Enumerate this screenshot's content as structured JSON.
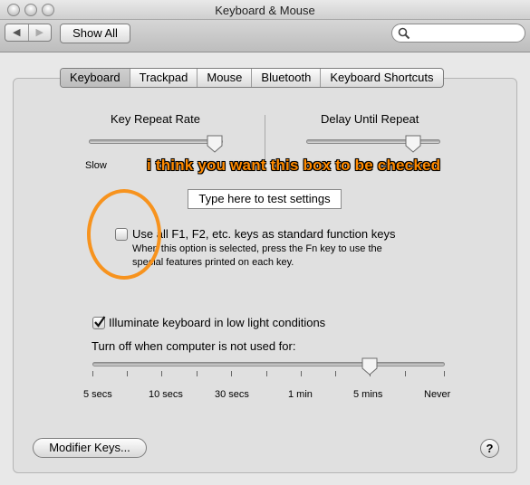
{
  "window": {
    "title": "Keyboard & Mouse"
  },
  "toolbar": {
    "back_glyph": "◀",
    "forward_glyph": "▶",
    "show_all_label": "Show All",
    "search_placeholder": ""
  },
  "tabs": [
    {
      "label": "Keyboard",
      "selected": true
    },
    {
      "label": "Trackpad",
      "selected": false
    },
    {
      "label": "Mouse",
      "selected": false
    },
    {
      "label": "Bluetooth",
      "selected": false
    },
    {
      "label": "Keyboard Shortcuts",
      "selected": false
    }
  ],
  "key_repeat": {
    "label": "Key Repeat Rate",
    "left_label": "Slow",
    "value_fraction": 0.94
  },
  "delay_repeat": {
    "label": "Delay Until Repeat",
    "value_fraction": 0.8
  },
  "test_field": {
    "value": "Type here to test settings"
  },
  "function_keys": {
    "label": "Use all F1, F2, etc. keys as standard function keys",
    "description_line1": "When this option is selected, press the Fn key to use the",
    "description_line2": "special features printed on each key.",
    "checked": false
  },
  "illuminate": {
    "label": "Illuminate keyboard in low light conditions",
    "checked": true
  },
  "turn_off": {
    "label": "Turn off when computer is not used for:",
    "ticks": [
      "5 secs",
      "10 secs",
      "30 secs",
      "1 min",
      "5 mins",
      "Never"
    ],
    "selected_index": 4
  },
  "buttons": {
    "modifier_keys": "Modifier Keys...",
    "help": "?"
  },
  "annotation": {
    "text": "i think you want this box to be checked",
    "color": "#ff8a00",
    "circle_color": "#f7931e"
  }
}
